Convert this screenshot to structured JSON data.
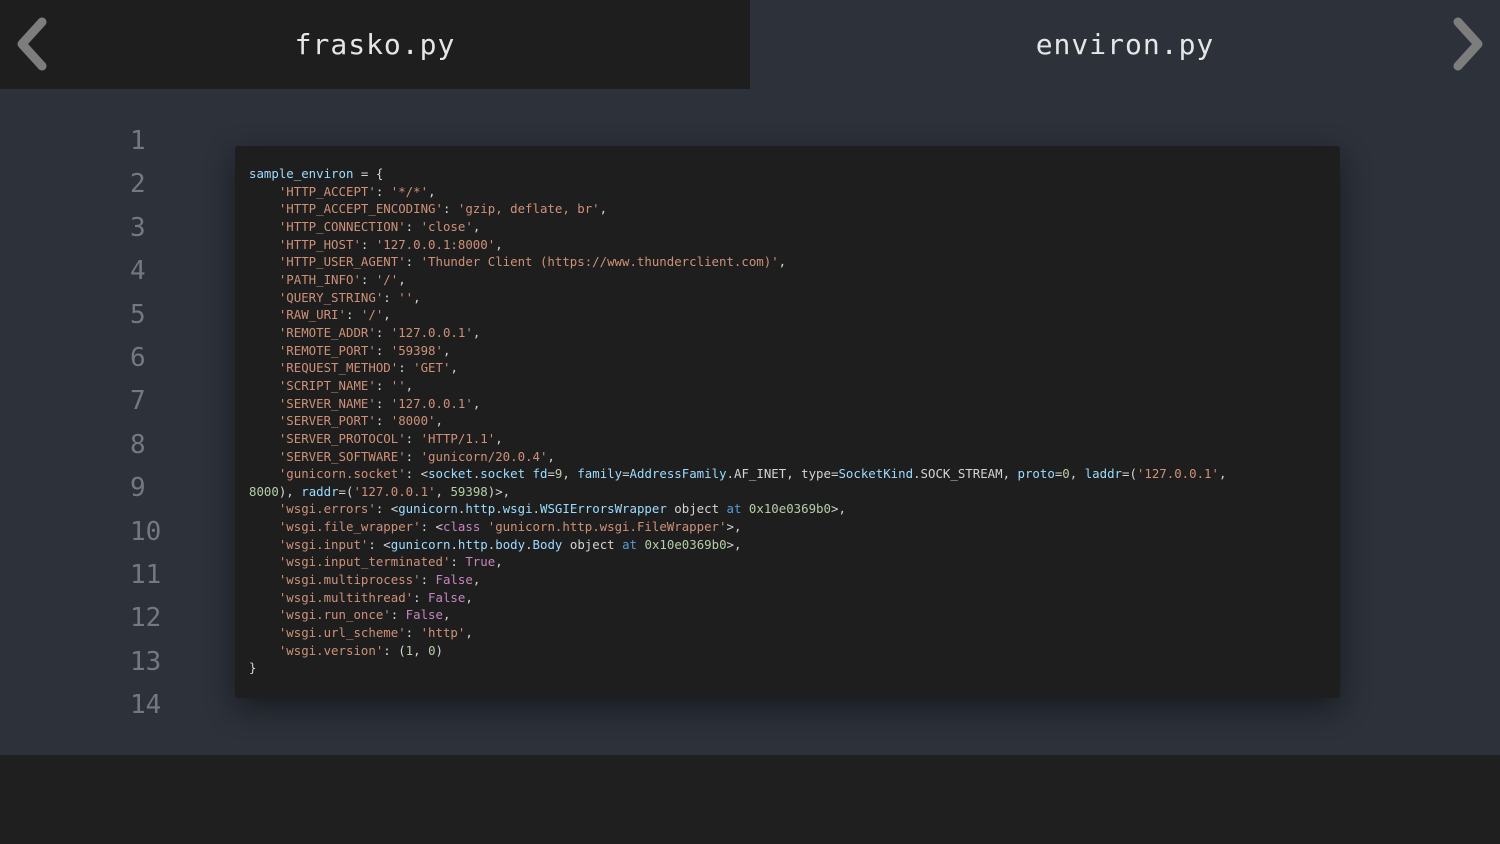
{
  "tabs": [
    {
      "label": "frasko.py",
      "active": false
    },
    {
      "label": "environ.py",
      "active": true
    }
  ],
  "nav": {
    "prev_icon": "chevron-left-icon",
    "next_icon": "chevron-right-icon"
  },
  "line_numbers": [
    "1",
    "2",
    "3",
    "4",
    "5",
    "6",
    "7",
    "8",
    "9",
    "10",
    "11",
    "12",
    "13",
    "14"
  ],
  "code": {
    "l01_var": "sample_environ",
    "l01_rest": " = {",
    "l02_key": "'HTTP_ACCEPT'",
    "l02_val": "'*/*'",
    "l03_key": "'HTTP_ACCEPT_ENCODING'",
    "l03_val": "'gzip, deflate, br'",
    "l04_key": "'HTTP_CONNECTION'",
    "l04_val": "'close'",
    "l05_key": "'HTTP_HOST'",
    "l05_val": "'127.0.0.1:8000'",
    "l06_key": "'HTTP_USER_AGENT'",
    "l06_val": "'Thunder Client (https://www.thunderclient.com)'",
    "l07_key": "'PATH_INFO'",
    "l07_val": "'/'",
    "l08_key": "'QUERY_STRING'",
    "l08_val": "''",
    "l09_key": "'RAW_URI'",
    "l09_val": "'/'",
    "l10_key": "'REMOTE_ADDR'",
    "l10_val": "'127.0.0.1'",
    "l11_key": "'REMOTE_PORT'",
    "l11_val": "'59398'",
    "l12_key": "'REQUEST_METHOD'",
    "l12_val": "'GET'",
    "l13_key": "'SCRIPT_NAME'",
    "l13_val": "''",
    "l14_key": "'SERVER_NAME'",
    "l14_val": "'127.0.0.1'",
    "l15_key": "'SERVER_PORT'",
    "l15_val": "'8000'",
    "l16_key": "'SERVER_PROTOCOL'",
    "l16_val": "'HTTP/1.1'",
    "l17_key": "'SERVER_SOFTWARE'",
    "l17_val": "'gunicorn/20.0.4'",
    "l18_key": "'gunicorn.socket'",
    "l18_t1": "socket",
    "l18_t2": "socket",
    "l18_v1": "fd",
    "l18_n1": "9",
    "l18_v2": "family",
    "l18_t3": "AddressFamily",
    "l18_t4": "AF_INET",
    "l18_v3": "type",
    "l18_t5": "SocketKind",
    "l18_t6": "SOCK_STREAM",
    "l18_v4": "proto",
    "l18_n2": "0",
    "l18_v5": "laddr",
    "l18_s1": "'127.0.0.1'",
    "l19_n1": "8000",
    "l19_v1": "raddr",
    "l19_s1": "'127.0.0.1'",
    "l19_n2": "59398",
    "l20_key": "'wsgi.errors'",
    "l20_t1": "gunicorn",
    "l20_t2": "http",
    "l20_t3": "wsgi",
    "l20_t4": "WSGIErrorsWrapper",
    "l20_obj": "object",
    "l20_at": "at",
    "l20_addr": "0x10e0369b0",
    "l21_key": "'wsgi.file_wrapper'",
    "l21_kw": "class",
    "l21_s": "'gunicorn.http.wsgi.FileWrapper'",
    "l22_key": "'wsgi.input'",
    "l22_t1": "gunicorn",
    "l22_t2": "http",
    "l22_t3": "body",
    "l22_t4": "Body",
    "l22_obj": "object",
    "l22_at": "at",
    "l22_addr": "0x10e0369b0",
    "l23_key": "'wsgi.input_terminated'",
    "l23_val": "True",
    "l24_key": "'wsgi.multiprocess'",
    "l24_val": "False",
    "l25_key": "'wsgi.multithread'",
    "l25_val": "False",
    "l26_key": "'wsgi.run_once'",
    "l26_val": "False",
    "l27_key": "'wsgi.url_scheme'",
    "l27_val": "'http'",
    "l28_key": "'wsgi.version'",
    "l28_n1": "1",
    "l28_n2": "0",
    "l29": "}"
  }
}
